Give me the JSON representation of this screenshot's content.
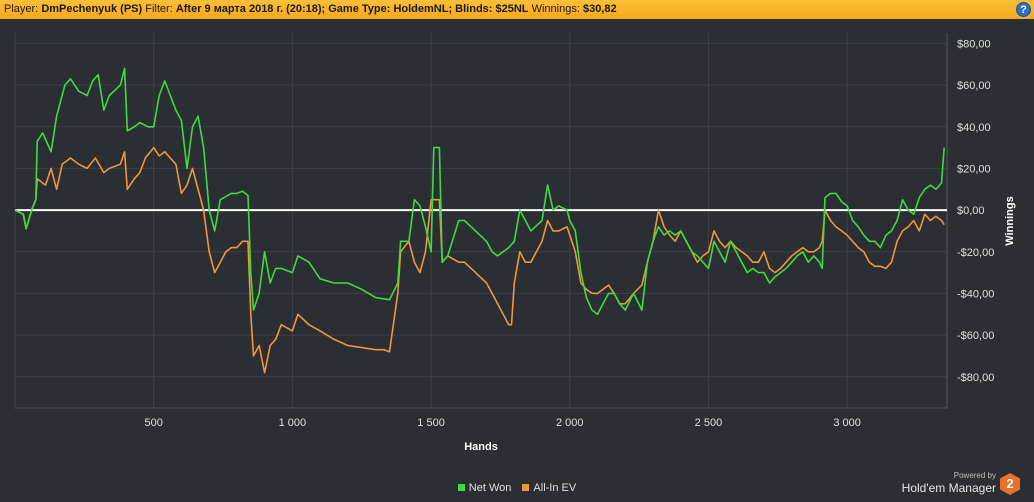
{
  "header": {
    "player_label": "Player:",
    "player_value": "DmPechenyuk (PS)",
    "filter_label": "Filter:",
    "filter_value": "After 9 марта 2018 г. (20:18); Game Type: HoldemNL; Blinds: $25NL",
    "winnings_label": "Winnings:",
    "winnings_value": "$30,82",
    "help_label": "?"
  },
  "brand": {
    "powered": "Powered by",
    "name": "Hold'em Manager",
    "logo": "2"
  },
  "colors": {
    "net_won": "#3ddc3d",
    "all_in_ev": "#f0963c",
    "zero_line": "#ffffff",
    "grid": "#3d4046",
    "background": "#2b2e33"
  },
  "chart_data": {
    "type": "line",
    "title": "",
    "xlabel": "Hands",
    "ylabel": "Winnings",
    "xlim": [
      0,
      3360
    ],
    "ylim": [
      -95,
      85
    ],
    "grid": true,
    "legend_placement": "bottom-center",
    "x_ticks": [
      500,
      1000,
      1500,
      2000,
      2500,
      3000
    ],
    "x_tick_labels": [
      "500",
      "1 000",
      "1 500",
      "2 000",
      "2 500",
      "3 000"
    ],
    "y_ticks": [
      80,
      60,
      40,
      20,
      0,
      -20,
      -40,
      -60,
      -80
    ],
    "y_tick_labels": [
      "$80,00",
      "$60,00",
      "$40,00",
      "$20,00",
      "$0,00",
      "-$20,00",
      "-$40,00",
      "-$60,00",
      "-$80,00"
    ],
    "series": [
      {
        "name": "Net Won",
        "points": [
          [
            0,
            0
          ],
          [
            30,
            -2
          ],
          [
            40,
            -9
          ],
          [
            60,
            0
          ],
          [
            75,
            5
          ],
          [
            80,
            33
          ],
          [
            100,
            37
          ],
          [
            130,
            28
          ],
          [
            150,
            45
          ],
          [
            180,
            60
          ],
          [
            200,
            63
          ],
          [
            230,
            57
          ],
          [
            260,
            55
          ],
          [
            280,
            62
          ],
          [
            300,
            65
          ],
          [
            320,
            48
          ],
          [
            340,
            55
          ],
          [
            380,
            60
          ],
          [
            395,
            68
          ],
          [
            405,
            38
          ],
          [
            430,
            40
          ],
          [
            450,
            42
          ],
          [
            480,
            40
          ],
          [
            500,
            40
          ],
          [
            520,
            55
          ],
          [
            540,
            62
          ],
          [
            560,
            55
          ],
          [
            580,
            48
          ],
          [
            600,
            43
          ],
          [
            620,
            20
          ],
          [
            640,
            40
          ],
          [
            660,
            45
          ],
          [
            680,
            30
          ],
          [
            700,
            0
          ],
          [
            720,
            -10
          ],
          [
            740,
            5
          ],
          [
            780,
            8
          ],
          [
            800,
            8
          ],
          [
            820,
            9
          ],
          [
            840,
            7
          ],
          [
            850,
            -30
          ],
          [
            860,
            -48
          ],
          [
            880,
            -40
          ],
          [
            900,
            -20
          ],
          [
            920,
            -35
          ],
          [
            940,
            -28
          ],
          [
            960,
            -28
          ],
          [
            1000,
            -30
          ],
          [
            1020,
            -22
          ],
          [
            1060,
            -25
          ],
          [
            1100,
            -33
          ],
          [
            1150,
            -35
          ],
          [
            1200,
            -35
          ],
          [
            1250,
            -38
          ],
          [
            1300,
            -42
          ],
          [
            1350,
            -43
          ],
          [
            1380,
            -35
          ],
          [
            1390,
            -15
          ],
          [
            1420,
            -15
          ],
          [
            1440,
            5
          ],
          [
            1460,
            2
          ],
          [
            1480,
            -8
          ],
          [
            1500,
            -20
          ],
          [
            1510,
            30
          ],
          [
            1530,
            30
          ],
          [
            1540,
            -25
          ],
          [
            1560,
            -22
          ],
          [
            1600,
            -5
          ],
          [
            1620,
            -5
          ],
          [
            1660,
            -10
          ],
          [
            1700,
            -15
          ],
          [
            1720,
            -20
          ],
          [
            1740,
            -22
          ],
          [
            1780,
            -18
          ],
          [
            1800,
            -15
          ],
          [
            1820,
            0
          ],
          [
            1840,
            -5
          ],
          [
            1860,
            -10
          ],
          [
            1900,
            -5
          ],
          [
            1920,
            12
          ],
          [
            1940,
            0
          ],
          [
            1960,
            2
          ],
          [
            1990,
            0
          ],
          [
            2000,
            -5
          ],
          [
            2020,
            -10
          ],
          [
            2040,
            -30
          ],
          [
            2060,
            -42
          ],
          [
            2080,
            -48
          ],
          [
            2100,
            -50
          ],
          [
            2120,
            -45
          ],
          [
            2140,
            -40
          ],
          [
            2160,
            -40
          ],
          [
            2180,
            -45
          ],
          [
            2200,
            -48
          ],
          [
            2230,
            -40
          ],
          [
            2260,
            -48
          ],
          [
            2280,
            -25
          ],
          [
            2300,
            -15
          ],
          [
            2320,
            -8
          ],
          [
            2340,
            -12
          ],
          [
            2360,
            -10
          ],
          [
            2380,
            -12
          ],
          [
            2400,
            -10
          ],
          [
            2420,
            -15
          ],
          [
            2440,
            -20
          ],
          [
            2460,
            -22
          ],
          [
            2480,
            -25
          ],
          [
            2500,
            -28
          ],
          [
            2520,
            -15
          ],
          [
            2540,
            -20
          ],
          [
            2560,
            -25
          ],
          [
            2580,
            -15
          ],
          [
            2600,
            -20
          ],
          [
            2620,
            -25
          ],
          [
            2640,
            -30
          ],
          [
            2660,
            -28
          ],
          [
            2680,
            -30
          ],
          [
            2700,
            -30
          ],
          [
            2720,
            -35
          ],
          [
            2740,
            -32
          ],
          [
            2760,
            -30
          ],
          [
            2780,
            -28
          ],
          [
            2800,
            -25
          ],
          [
            2820,
            -22
          ],
          [
            2840,
            -20
          ],
          [
            2860,
            -25
          ],
          [
            2880,
            -22
          ],
          [
            2900,
            -25
          ],
          [
            2910,
            -28
          ],
          [
            2920,
            6
          ],
          [
            2940,
            8
          ],
          [
            2960,
            8
          ],
          [
            2980,
            4
          ],
          [
            3000,
            2
          ],
          [
            3020,
            -5
          ],
          [
            3040,
            -8
          ],
          [
            3060,
            -12
          ],
          [
            3080,
            -15
          ],
          [
            3100,
            -15
          ],
          [
            3120,
            -18
          ],
          [
            3140,
            -12
          ],
          [
            3160,
            -10
          ],
          [
            3180,
            -5
          ],
          [
            3200,
            5
          ],
          [
            3220,
            0
          ],
          [
            3240,
            -2
          ],
          [
            3260,
            6
          ],
          [
            3280,
            10
          ],
          [
            3300,
            12
          ],
          [
            3320,
            10
          ],
          [
            3340,
            13
          ],
          [
            3350,
            30
          ]
        ]
      },
      {
        "name": "All-In EV",
        "points": [
          [
            0,
            0
          ],
          [
            30,
            -2
          ],
          [
            40,
            -9
          ],
          [
            60,
            0
          ],
          [
            75,
            5
          ],
          [
            80,
            15
          ],
          [
            110,
            12
          ],
          [
            130,
            20
          ],
          [
            150,
            10
          ],
          [
            170,
            22
          ],
          [
            200,
            25
          ],
          [
            230,
            22
          ],
          [
            260,
            20
          ],
          [
            290,
            25
          ],
          [
            320,
            18
          ],
          [
            340,
            20
          ],
          [
            380,
            22
          ],
          [
            395,
            28
          ],
          [
            405,
            10
          ],
          [
            430,
            15
          ],
          [
            450,
            18
          ],
          [
            470,
            25
          ],
          [
            500,
            30
          ],
          [
            520,
            26
          ],
          [
            540,
            28
          ],
          [
            560,
            25
          ],
          [
            580,
            22
          ],
          [
            600,
            8
          ],
          [
            620,
            12
          ],
          [
            640,
            20
          ],
          [
            660,
            10
          ],
          [
            680,
            0
          ],
          [
            700,
            -20
          ],
          [
            720,
            -30
          ],
          [
            740,
            -25
          ],
          [
            760,
            -20
          ],
          [
            780,
            -18
          ],
          [
            800,
            -18
          ],
          [
            820,
            -15
          ],
          [
            840,
            -15
          ],
          [
            850,
            -50
          ],
          [
            860,
            -70
          ],
          [
            880,
            -65
          ],
          [
            900,
            -78
          ],
          [
            920,
            -65
          ],
          [
            940,
            -62
          ],
          [
            960,
            -55
          ],
          [
            1000,
            -58
          ],
          [
            1020,
            -50
          ],
          [
            1060,
            -55
          ],
          [
            1100,
            -58
          ],
          [
            1150,
            -62
          ],
          [
            1200,
            -65
          ],
          [
            1250,
            -66
          ],
          [
            1300,
            -67
          ],
          [
            1330,
            -67
          ],
          [
            1350,
            -68
          ],
          [
            1380,
            -40
          ],
          [
            1390,
            -20
          ],
          [
            1420,
            -15
          ],
          [
            1440,
            -25
          ],
          [
            1460,
            -30
          ],
          [
            1480,
            -20
          ],
          [
            1500,
            5
          ],
          [
            1530,
            5
          ],
          [
            1540,
            -25
          ],
          [
            1560,
            -22
          ],
          [
            1600,
            -25
          ],
          [
            1620,
            -25
          ],
          [
            1660,
            -30
          ],
          [
            1700,
            -35
          ],
          [
            1720,
            -40
          ],
          [
            1740,
            -45
          ],
          [
            1760,
            -50
          ],
          [
            1780,
            -55
          ],
          [
            1790,
            -55
          ],
          [
            1800,
            -35
          ],
          [
            1820,
            -20
          ],
          [
            1840,
            -25
          ],
          [
            1860,
            -25
          ],
          [
            1900,
            -15
          ],
          [
            1920,
            -5
          ],
          [
            1940,
            -10
          ],
          [
            1960,
            -10
          ],
          [
            1990,
            -8
          ],
          [
            2000,
            -12
          ],
          [
            2020,
            -20
          ],
          [
            2040,
            -35
          ],
          [
            2060,
            -38
          ],
          [
            2080,
            -40
          ],
          [
            2100,
            -40
          ],
          [
            2120,
            -38
          ],
          [
            2140,
            -36
          ],
          [
            2160,
            -40
          ],
          [
            2180,
            -45
          ],
          [
            2200,
            -45
          ],
          [
            2230,
            -40
          ],
          [
            2260,
            -36
          ],
          [
            2280,
            -25
          ],
          [
            2300,
            -15
          ],
          [
            2320,
            0
          ],
          [
            2340,
            -8
          ],
          [
            2360,
            -12
          ],
          [
            2380,
            -15
          ],
          [
            2400,
            -10
          ],
          [
            2420,
            -15
          ],
          [
            2440,
            -20
          ],
          [
            2460,
            -25
          ],
          [
            2480,
            -22
          ],
          [
            2500,
            -20
          ],
          [
            2520,
            -10
          ],
          [
            2540,
            -15
          ],
          [
            2560,
            -18
          ],
          [
            2580,
            -15
          ],
          [
            2600,
            -18
          ],
          [
            2620,
            -20
          ],
          [
            2640,
            -22
          ],
          [
            2660,
            -25
          ],
          [
            2680,
            -25
          ],
          [
            2700,
            -20
          ],
          [
            2720,
            -28
          ],
          [
            2740,
            -30
          ],
          [
            2760,
            -28
          ],
          [
            2780,
            -25
          ],
          [
            2800,
            -22
          ],
          [
            2820,
            -20
          ],
          [
            2840,
            -18
          ],
          [
            2860,
            -20
          ],
          [
            2880,
            -20
          ],
          [
            2900,
            -18
          ],
          [
            2910,
            -15
          ],
          [
            2920,
            0
          ],
          [
            2940,
            -5
          ],
          [
            2960,
            -8
          ],
          [
            2980,
            -10
          ],
          [
            3000,
            -12
          ],
          [
            3020,
            -15
          ],
          [
            3040,
            -18
          ],
          [
            3060,
            -20
          ],
          [
            3080,
            -25
          ],
          [
            3100,
            -27
          ],
          [
            3120,
            -27
          ],
          [
            3140,
            -28
          ],
          [
            3160,
            -25
          ],
          [
            3180,
            -15
          ],
          [
            3200,
            -10
          ],
          [
            3220,
            -8
          ],
          [
            3240,
            -5
          ],
          [
            3260,
            -10
          ],
          [
            3280,
            -2
          ],
          [
            3300,
            -5
          ],
          [
            3320,
            -3
          ],
          [
            3340,
            -5
          ],
          [
            3350,
            -7
          ]
        ]
      }
    ]
  }
}
